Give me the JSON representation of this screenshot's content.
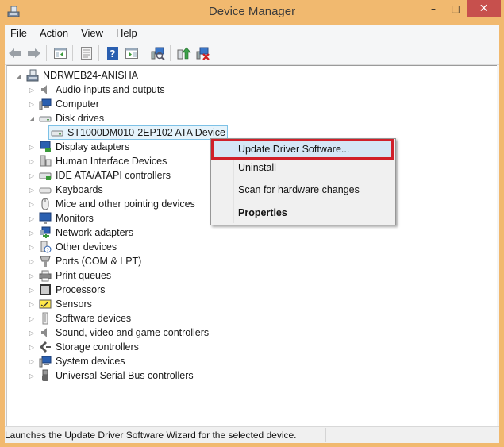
{
  "window": {
    "title": "Device Manager",
    "controls": {
      "minimize": "–",
      "maximize": "□",
      "close": "✕"
    }
  },
  "menubar": [
    "File",
    "Action",
    "View",
    "Help"
  ],
  "toolbar": {
    "buttons": [
      "back-arrow-icon",
      "forward-arrow-icon",
      "show-hide-console-tree-icon",
      "properties-icon",
      "help-icon",
      "show-action-pane-icon",
      "scan-hardware-icon",
      "update-driver-icon",
      "uninstall-device-icon"
    ]
  },
  "tree": {
    "root": "NDRWEB24-ANISHA",
    "categories": [
      {
        "label": "Audio inputs and outputs",
        "icon": "speaker-icon"
      },
      {
        "label": "Computer",
        "icon": "computer-icon"
      },
      {
        "label": "Disk drives",
        "icon": "disk-drive-icon",
        "expanded": true,
        "children": [
          "ST1000DM010-2EP102 ATA Device"
        ]
      },
      {
        "label": "Display adapters",
        "icon": "display-adapter-icon"
      },
      {
        "label": "Human Interface Devices",
        "icon": "hid-icon"
      },
      {
        "label": "IDE ATA/ATAPI controllers",
        "icon": "ide-controller-icon"
      },
      {
        "label": "Keyboards",
        "icon": "keyboard-icon"
      },
      {
        "label": "Mice and other pointing devices",
        "icon": "mouse-icon"
      },
      {
        "label": "Monitors",
        "icon": "monitor-icon"
      },
      {
        "label": "Network adapters",
        "icon": "network-adapter-icon"
      },
      {
        "label": "Other devices",
        "icon": "unknown-device-icon"
      },
      {
        "label": "Ports (COM & LPT)",
        "icon": "port-icon"
      },
      {
        "label": "Print queues",
        "icon": "printer-icon"
      },
      {
        "label": "Processors",
        "icon": "processor-icon"
      },
      {
        "label": "Sensors",
        "icon": "sensor-icon"
      },
      {
        "label": "Software devices",
        "icon": "software-device-icon"
      },
      {
        "label": "Sound, video and game controllers",
        "icon": "sound-icon"
      },
      {
        "label": "Storage controllers",
        "icon": "storage-controller-icon"
      },
      {
        "label": "System devices",
        "icon": "system-device-icon"
      },
      {
        "label": "Universal Serial Bus controllers",
        "icon": "usb-icon"
      }
    ]
  },
  "context_menu": {
    "items": [
      "Update Driver Software...",
      "Uninstall",
      "Scan for hardware changes",
      "Properties"
    ],
    "highlighted": "Update Driver Software...",
    "bold": "Properties"
  },
  "statusbar": {
    "text": "Launches the Update Driver Software Wizard for the selected device."
  },
  "colors": {
    "frame": "#f1b96f",
    "close": "#c7504d",
    "highlight_box": "#d0202a",
    "selection": "#e5f3fb"
  }
}
